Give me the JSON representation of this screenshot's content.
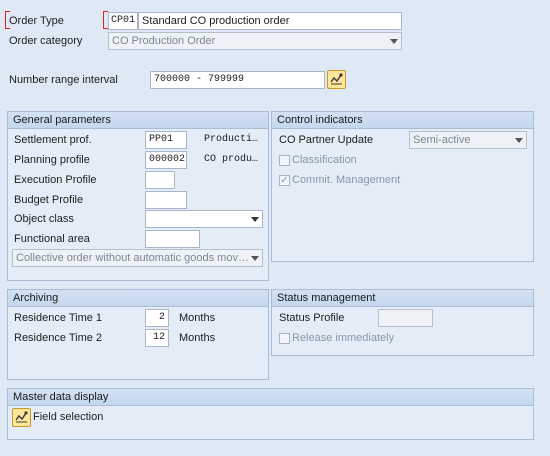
{
  "header": {
    "order_type_label": "Order Type",
    "order_type_code": "CP01",
    "order_type_text": "Standard CO production order",
    "order_category_label": "Order category",
    "order_category_value": "CO Production Order",
    "number_range_label": "Number range interval",
    "number_range_value": "700000 - 799999"
  },
  "general_parameters": {
    "title": "General parameters",
    "settlement_label": "Settlement prof.",
    "settlement_value": "PP01",
    "settlement_desc": "Producti…",
    "planning_label": "Planning profile",
    "planning_value": "000002",
    "planning_desc": "CO produ…",
    "execution_label": "Execution Profile",
    "budget_label": "Budget Profile",
    "object_class_label": "Object class",
    "functional_area_label": "Functional area",
    "goods_movement_value": "Collective order without automatic goods mov…"
  },
  "control_indicators": {
    "title": "Control indicators",
    "co_partner_label": "CO Partner Update",
    "co_partner_value": "Semi-active",
    "classification_label": "Classification",
    "classification_checked": false,
    "commit_label": "Commit. Management",
    "commit_checked": true,
    "check_mark": "✓"
  },
  "archiving": {
    "title": "Archiving",
    "residence1_label": "Residence Time 1",
    "residence1_value": "2",
    "residence1_unit": "Months",
    "residence2_label": "Residence Time 2",
    "residence2_value": "12",
    "residence2_unit": "Months"
  },
  "status_management": {
    "title": "Status management",
    "status_profile_label": "Status Profile",
    "release_label": "Release immediately",
    "release_checked": false
  },
  "master_data": {
    "title": "Master data display",
    "field_selection_label": "Field selection"
  },
  "colors": {
    "background": "#dfe9f5",
    "group_title": "#c4d7ee",
    "required_mark": "#e0241b",
    "f4_button": "#fde59a"
  }
}
